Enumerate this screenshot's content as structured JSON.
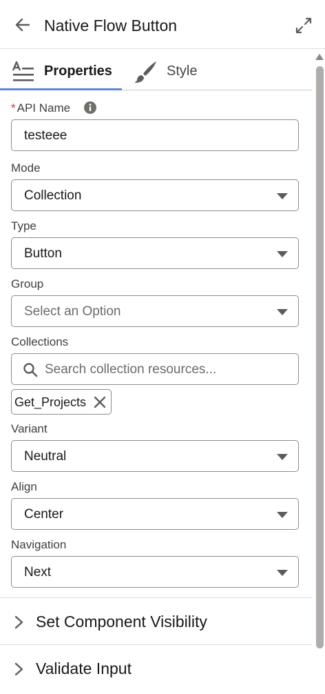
{
  "header": {
    "title": "Native Flow Button",
    "back_icon": "arrow-left-icon",
    "expand_icon": "expand-icon"
  },
  "tabs": [
    {
      "label": "Properties",
      "icon": "text-lines-icon",
      "active": true
    },
    {
      "label": "Style",
      "icon": "paintbrush-icon",
      "active": false
    }
  ],
  "accent_color": "#5b87d8",
  "required_color": "#c23934",
  "form": {
    "api_name": {
      "label": "API Name",
      "required_mark": "*",
      "value": "testeee"
    },
    "mode": {
      "label": "Mode",
      "value": "Collection"
    },
    "type": {
      "label": "Type",
      "value": "Button"
    },
    "group": {
      "label": "Group",
      "placeholder": "Select an Option"
    },
    "collections": {
      "label": "Collections",
      "placeholder": "Search collection resources...",
      "selected": "Get_Projects"
    },
    "variant": {
      "label": "Variant",
      "value": "Neutral"
    },
    "align": {
      "label": "Align",
      "value": "Center"
    },
    "navigation": {
      "label": "Navigation",
      "value": "Next"
    }
  },
  "sections": [
    {
      "label": "Set Component Visibility"
    },
    {
      "label": "Validate Input"
    }
  ]
}
